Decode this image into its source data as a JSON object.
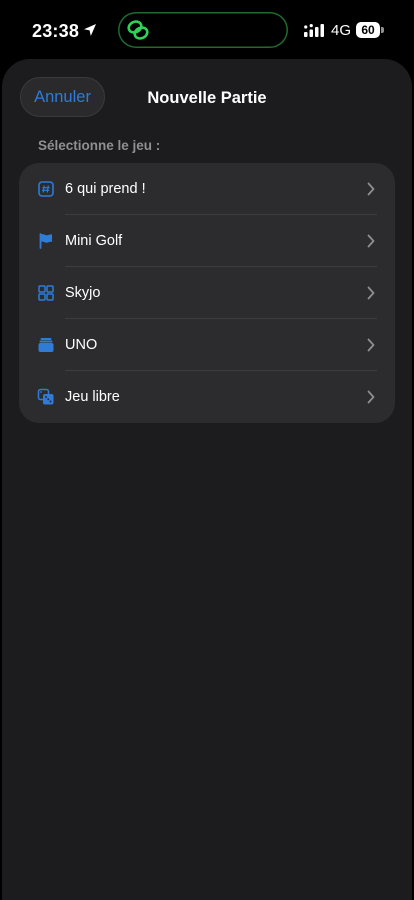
{
  "status_bar": {
    "time": "23:38",
    "network": "4G",
    "battery_level": "60",
    "icons": [
      "location-arrow-icon",
      "link-icon",
      "signal-icon",
      "battery-icon"
    ]
  },
  "colors": {
    "accent": "#2f7bd6",
    "sheet_background": "#1c1c1e",
    "card_background": "#2c2c2e",
    "secondary_text": "#8e8e93",
    "island_link": "#30d158"
  },
  "sheet": {
    "cancel_label": "Annuler",
    "title": "Nouvelle Partie",
    "section_label": "Sélectionne le jeu :"
  },
  "games": [
    {
      "label": "6 qui prend !",
      "icon": "number-square-icon"
    },
    {
      "label": "Mini Golf",
      "icon": "flag-icon"
    },
    {
      "label": "Skyjo",
      "icon": "grid-icon"
    },
    {
      "label": "UNO",
      "icon": "card-stack-icon"
    },
    {
      "label": "Jeu libre",
      "icon": "dice-icon"
    }
  ]
}
